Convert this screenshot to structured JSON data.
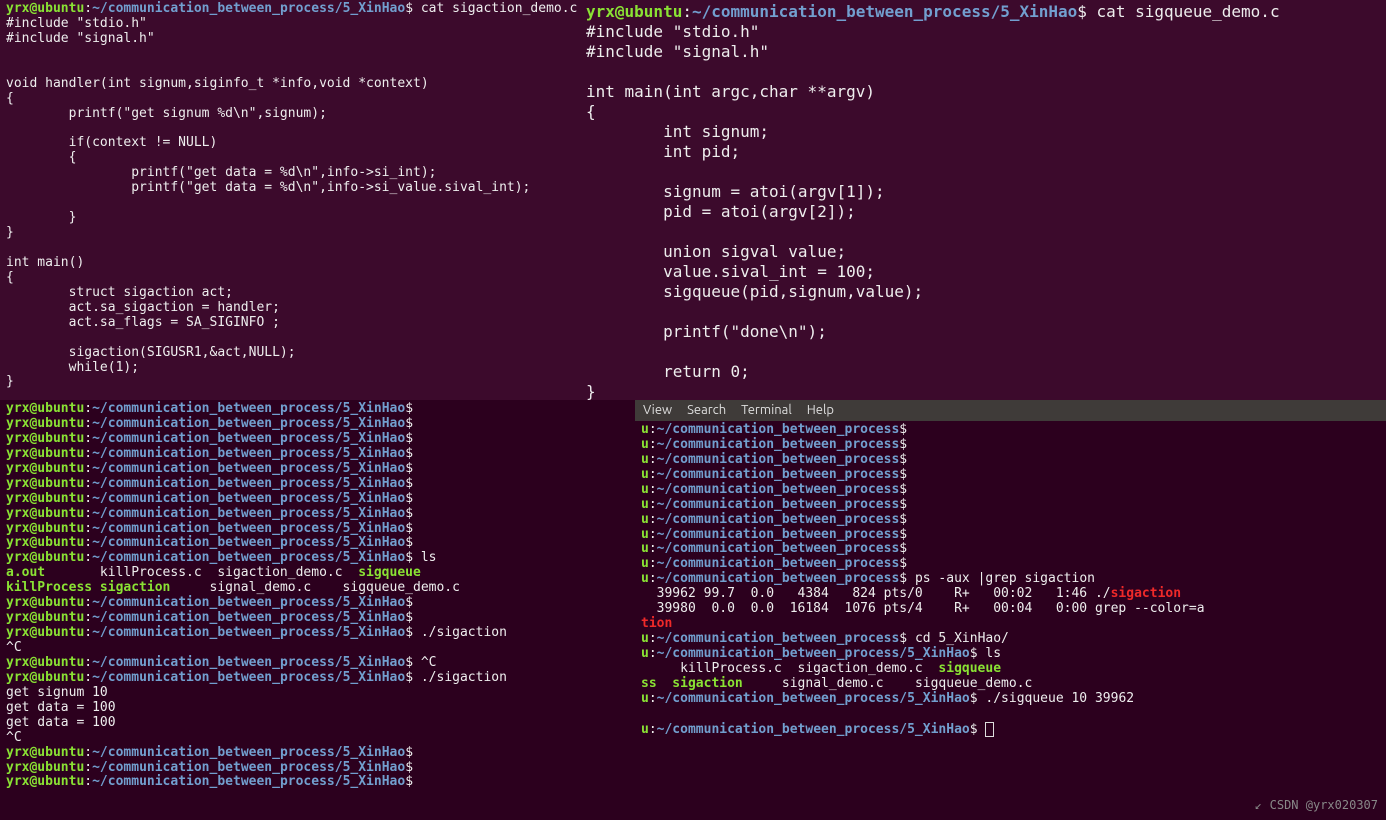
{
  "top_left": {
    "prompt_user": "yrx@ubuntu",
    "prompt_path": "~/communication_between_process/5_XinHao",
    "command": "cat sigaction_demo.c",
    "code": "#include \"stdio.h\"\n#include \"signal.h\"\n\n\nvoid handler(int signum,siginfo_t *info,void *context)\n{\n        printf(\"get signum %d\\n\",signum);\n\n        if(context != NULL)\n        {\n                printf(\"get data = %d\\n\",info->si_int);\n                printf(\"get data = %d\\n\",info->si_value.sival_int);\n\n        }\n}\n\nint main()\n{\n        struct sigaction act;\n        act.sa_sigaction = handler;\n        act.sa_flags = SA_SIGINFO ;\n\n        sigaction(SIGUSR1,&act,NULL);\n        while(1);\n}"
  },
  "top_right": {
    "prompt_user": "yrx@ubuntu",
    "prompt_path": "~/communication_between_process/5_XinHao",
    "command": "cat sigqueue_demo.c",
    "code": "#include \"stdio.h\"\n#include \"signal.h\"\n\nint main(int argc,char **argv)\n{\n        int signum;\n        int pid;\n\n        signum = atoi(argv[1]);\n        pid = atoi(argv[2]);\n\n        union sigval value;\n        value.sival_int = 100;\n        sigqueue(pid,signum,value);\n\n        printf(\"done\\n\");\n\n        return 0;\n}"
  },
  "bottom_left": {
    "prompt_user": "yrx@ubuntu",
    "prompt_path": "~/communication_between_process/5_XinHao",
    "empty_count": 10,
    "ls_cmd": "ls",
    "ls_line1": {
      "a": "a.out",
      "b": "killProcess.c  sigaction_demo.c",
      "c": "sigqueue"
    },
    "ls_line2": {
      "a": "killProcess",
      "b": "sigaction",
      "c": "signal_demo.c    sigqueue_demo.c"
    },
    "run1": "./sigaction",
    "sigint1": "^C",
    "sigint2": "^C",
    "run2": "./sigaction",
    "out1": "get signum 10",
    "out2": "get data = 100",
    "out3": "get data = 100",
    "sigint3": "^C",
    "trail_count": 3
  },
  "bottom_right": {
    "menu": [
      "View",
      "Search",
      "Terminal",
      "Help"
    ],
    "short_path": "~/communication_between_process",
    "empty_count": 10,
    "ps_cmd": "ps -aux |grep sigaction",
    "ps1_pre": "  39962 99.7  0.0   4384   824 pts/0    R+   00:02   1:46 ./",
    "ps1_hl": "sigaction",
    "ps2_pre": "  39980  0.0  0.0  16184  1076 pts/4    R+   00:04   0:00 grep --color=a",
    "ps2_hl": "tion",
    "cd_cmd": "cd 5_XinHao/",
    "prompt_path2": "~/communication_between_process/5_XinHao",
    "ls_cmd": "ls",
    "ls_line1": {
      "a": "",
      "b": "killProcess.c  sigaction_demo.c",
      "c": "sigqueue"
    },
    "ls_line2": {
      "a": "ss",
      "b": "sigaction",
      "c": "signal_demo.c    sigqueue_demo.c"
    },
    "sq_cmd": "./sigqueue 10 39962"
  },
  "watermark_arrow": "↙",
  "watermark": "CSDN @yrx020307"
}
